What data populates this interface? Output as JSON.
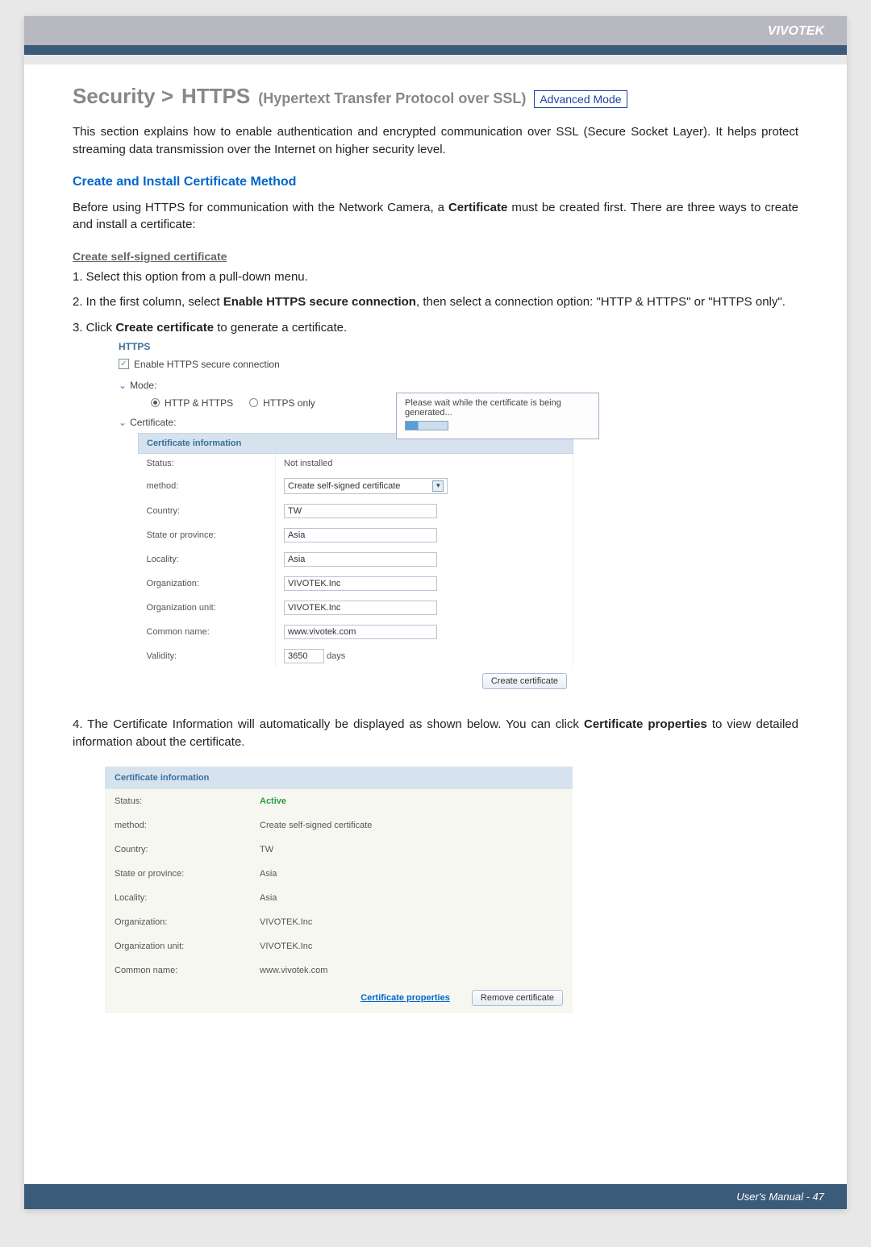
{
  "brand": "VIVOTEK",
  "heading": {
    "breadcrumb1": "Security >",
    "breadcrumb2": "HTTPS",
    "subtitle": "(Hypertext Transfer Protocol over SSL)",
    "badge": "Advanced Mode"
  },
  "intro": "This section explains how to enable authentication and encrypted communication over SSL (Secure Socket Layer). It helps protect streaming data transmission over the Internet on higher security level.",
  "section1_title": "Create and Install Certificate Method",
  "section1_intro_a": "Before using HTTPS for communication with the Network Camera, a ",
  "section1_intro_bold": "Certificate",
  "section1_intro_b": " must be created first. There are three ways to create and install a certificate:",
  "subsect_underline": "Create self-signed certificate",
  "steps": [
    "1. Select this option from a pull-down menu.",
    "2. In the first column, select Enable HTTPS secure connection, then select a connection option: \"HTTP & HTTPS\" or \"HTTPS only\".",
    "3. Click Create certificate to generate a certificate."
  ],
  "step2_prefix": "2. In the first column, select ",
  "step2_bold": "Enable HTTPS secure connection",
  "step2_suffix": ", then select a connection option: \"HTTP & HTTPS\" or \"HTTPS only\".",
  "step3_prefix": "3. Click ",
  "step3_bold": "Create certificate",
  "step3_suffix": " to generate a certificate.",
  "panel1": {
    "legend": "HTTPS",
    "enable_label": "Enable HTTPS secure connection",
    "enable_checked": "✓",
    "mode_label": "Mode:",
    "radio1": "HTTP & HTTPS",
    "radio2": "HTTPS only",
    "cert_label": "Certificate:",
    "table_header": "Certificate information",
    "rows": {
      "status_label": "Status:",
      "status_value": "Not installed",
      "method_label": "method:",
      "method_value": "Create self-signed certificate",
      "country_label": "Country:",
      "country_value": "TW",
      "state_label": "State or province:",
      "state_value": "Asia",
      "locality_label": "Locality:",
      "locality_value": "Asia",
      "org_label": "Organization:",
      "org_value": "VIVOTEK.Inc",
      "orgunit_label": "Organization unit:",
      "orgunit_value": "VIVOTEK.Inc",
      "common_label": "Common name:",
      "common_value": "www.vivotek.com",
      "validity_label": "Validity:",
      "validity_value": "3650",
      "validity_unit": "days"
    },
    "create_button": "Create certificate",
    "wait_text": "Please wait while the certificate is being generated..."
  },
  "step4_prefix": "4. The Certificate Information will automatically be displayed as shown below. You can click ",
  "step4_bold": "Certificate properties",
  "step4_suffix": " to view detailed information about the certificate.",
  "panel2": {
    "table_header": "Certificate information",
    "rows": {
      "status_label": "Status:",
      "status_value": "Active",
      "method_label": "method:",
      "method_value": "Create self-signed certificate",
      "country_label": "Country:",
      "country_value": "TW",
      "state_label": "State or province:",
      "state_value": "Asia",
      "locality_label": "Locality:",
      "locality_value": "Asia",
      "org_label": "Organization:",
      "org_value": "VIVOTEK.Inc",
      "orgunit_label": "Organization unit:",
      "orgunit_value": "VIVOTEK.Inc",
      "common_label": "Common name:",
      "common_value": "www.vivotek.com"
    },
    "link": "Certificate properties",
    "remove_button": "Remove certificate"
  },
  "footer": "User's Manual - 47"
}
